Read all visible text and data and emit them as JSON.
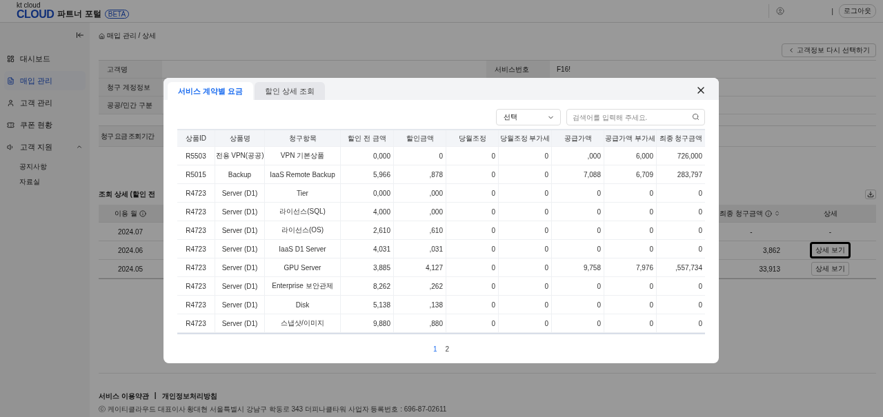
{
  "header": {
    "logo_small": "kt cloud",
    "logo": "CLOUD",
    "portal": "파트너 포털",
    "badge": "BETA",
    "separator": "|",
    "logout": "로그아웃"
  },
  "sidebar": {
    "items": [
      {
        "label": "대시보드",
        "selected": false
      },
      {
        "label": "매입 관리",
        "selected": true
      },
      {
        "label": "고객 관리",
        "selected": false
      },
      {
        "label": "쿠폰 현황",
        "selected": false
      },
      {
        "label": "고객 지원",
        "selected": false,
        "expanded": true,
        "children": [
          {
            "label": "공지사항"
          },
          {
            "label": "자료실"
          }
        ]
      }
    ]
  },
  "breadcrumb": "매입 관리 / 상세",
  "back_button": "고객정보 다시 선택하기",
  "info": {
    "rows": [
      {
        "label": "고객명",
        "label_2": "서비스번호",
        "value_2": "F16!"
      },
      {
        "label": "청구 계정정보"
      },
      {
        "label": "공공/민간 구분"
      }
    ],
    "period_label": "청구 요금 조회 기간"
  },
  "summary": {
    "title": "조회 상세 (할인 전",
    "columns": [
      {
        "label": "이용 월",
        "info": true,
        "sort": false
      },
      {
        "label": "최종 청구금액",
        "info": true,
        "sort": true
      },
      {
        "label": "상세",
        "info": false,
        "sort": false
      }
    ],
    "rows": [
      {
        "month": "2024.07",
        "amount": "-",
        "detail": "-",
        "kind": "text"
      },
      {
        "month": "2024.06",
        "amount": "3,862",
        "detail": "상세 보기",
        "kind": "button",
        "focused": true
      },
      {
        "month": "2024.05",
        "amount": "33,913",
        "detail": "상세 보기",
        "kind": "button",
        "focused": false
      }
    ]
  },
  "footer": {
    "links": [
      "서비스 이용약관",
      "개인정보처리방침"
    ],
    "separator": "|",
    "company": "ⓒ 케이티클라우드 대표이사 황대현 서울특별시 강남구 학동로 343 더피나클타워 사업자 등록번호 : 696-87-02611"
  },
  "modal": {
    "tabs": [
      {
        "label": "서비스 계약별 요금",
        "selected": true
      },
      {
        "label": "할인 상세 조회",
        "selected": false
      }
    ],
    "select": "선택",
    "search": {
      "placeholder": "검색어를 입력해 주세요."
    },
    "columns": [
      "상품ID",
      "상품명",
      "청구항목",
      "할인 전 금액",
      "할인금액",
      "당월조정",
      "당월조정 부가세",
      "공급가액",
      "공급가액 부가세",
      "최종 청구금액"
    ],
    "rows": [
      [
        "R5503",
        "전용 VPN(공공)",
        "VPN 기본상품",
        "0,000",
        "0",
        "0",
        "0",
        ",000",
        "6,000",
        "726,000"
      ],
      [
        "R5015",
        "Backup",
        "IaaS Remote Backup",
        "5,966",
        ",878",
        "0",
        "0",
        "7,088",
        "6,709",
        "283,797"
      ],
      [
        "R4723",
        "Server (D1)",
        "Tier",
        "0,000",
        ",000",
        "0",
        "0",
        "0",
        "0",
        "0"
      ],
      [
        "R4723",
        "Server (D1)",
        "라이선스(SQL)",
        "4,000",
        ",000",
        "0",
        "0",
        "0",
        "0",
        "0"
      ],
      [
        "R4723",
        "Server (D1)",
        "라이선스(OS)",
        "2,610",
        ",610",
        "0",
        "0",
        "0",
        "0",
        "0"
      ],
      [
        "R4723",
        "Server (D1)",
        "IaaS D1 Server",
        "4,031",
        ",031",
        "0",
        "0",
        "0",
        "0",
        "0"
      ],
      [
        "R4723",
        "Server (D1)",
        "GPU Server",
        "3,885",
        "4,127",
        "0",
        "0",
        "9,758",
        "7,976",
        ",557,734"
      ],
      [
        "R4723",
        "Server (D1)",
        "Enterprise 보안관제",
        "8,262",
        ",262",
        "0",
        "0",
        "0",
        "0",
        "0"
      ],
      [
        "R4723",
        "Server (D1)",
        "Disk",
        "5,138",
        ",138",
        "0",
        "0",
        "0",
        "0",
        "0"
      ],
      [
        "R4723",
        "Server (D1)",
        "스냅샷/이미지",
        "9,880",
        ",880",
        "0",
        "0",
        "0",
        "0",
        "0"
      ]
    ],
    "pages": [
      {
        "label": "1",
        "selected": true
      },
      {
        "label": "2",
        "selected": false
      }
    ]
  }
}
